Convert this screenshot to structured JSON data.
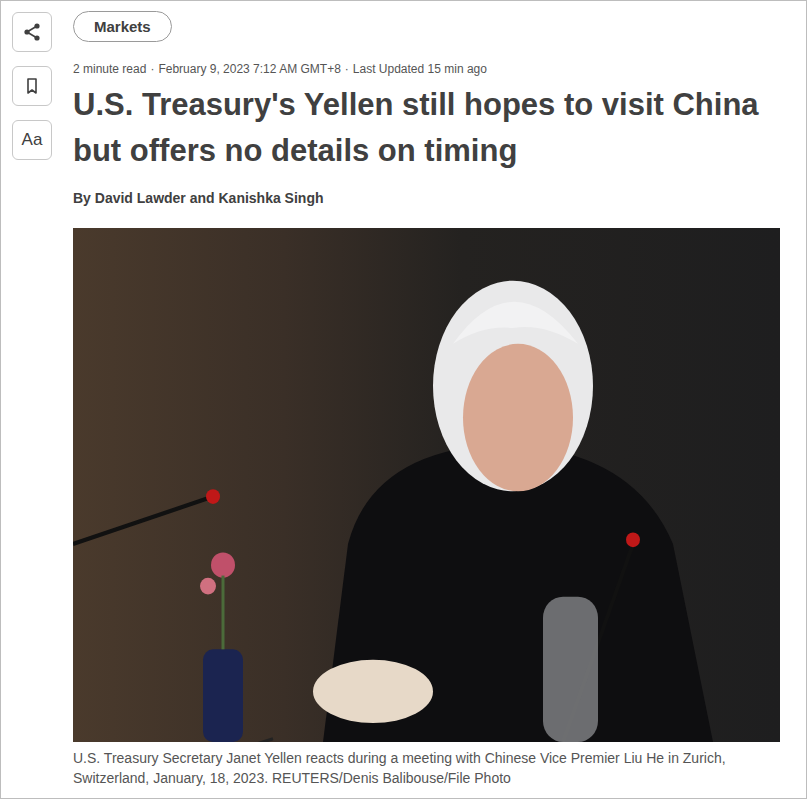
{
  "sidebar": {
    "font_button": "Aa"
  },
  "section_tag": "Markets",
  "meta": {
    "items": [
      "2 minute read",
      "February 9, 2023 7:12 AM GMT+8",
      "Last Updated 15 min ago"
    ],
    "separator": "·"
  },
  "headline": "U.S. Treasury's Yellen still hopes to visit China but offers no details on timing",
  "byline": "By David Lawder and Kanishka Singh",
  "caption": "U.S. Treasury Secretary Janet Yellen reacts during a meeting with Chinese Vice Premier Liu He in Zurich, Switzerland, January, 18, 2023. REUTERS/Denis Balibouse/File Photo"
}
